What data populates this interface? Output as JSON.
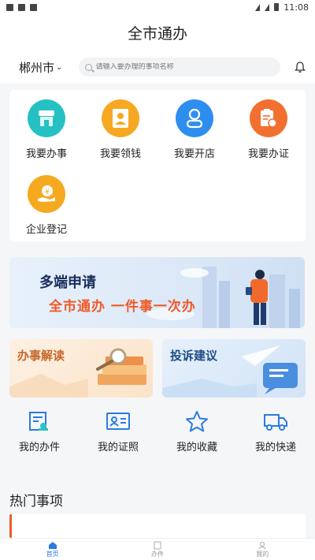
{
  "statusbar": {
    "time": "11:08"
  },
  "header": {
    "title": "全市通办"
  },
  "search": {
    "city": "郴州市",
    "placeholder": "请输入要办理的事项名称"
  },
  "services": [
    {
      "label": "我要办事",
      "icon": "shop-icon",
      "color": "#25c0c3"
    },
    {
      "label": "我要领钱",
      "icon": "id-card-icon",
      "color": "#f7a823"
    },
    {
      "label": "我要开店",
      "icon": "person-icon",
      "color": "#2e8ef0"
    },
    {
      "label": "我要办证",
      "icon": "certificate-icon",
      "color": "#f2702f"
    },
    {
      "label": "企业登记",
      "icon": "coin-hand-icon",
      "color": "#f5a91f"
    }
  ],
  "banner": {
    "title": "多端申请",
    "subtitle": "全市通办  一件事一次办"
  },
  "cards": [
    {
      "label": "办事解读"
    },
    {
      "label": "投诉建议"
    }
  ],
  "mine": [
    {
      "label": "我的办件",
      "icon": "document-icon"
    },
    {
      "label": "我的证照",
      "icon": "license-icon"
    },
    {
      "label": "我的收藏",
      "icon": "star-icon"
    },
    {
      "label": "我的快递",
      "icon": "truck-icon"
    }
  ],
  "hot": {
    "title": "热门事项"
  },
  "tabbar": [
    {
      "label": "首页",
      "icon": "home-icon",
      "active": true
    },
    {
      "label": "办件",
      "icon": "file-icon",
      "active": false
    },
    {
      "label": "我的",
      "icon": "user-icon",
      "active": false
    }
  ],
  "colors": {
    "accent": "#2a7be4",
    "orange": "#f05a28",
    "icon_blue": "#2a7be4"
  }
}
